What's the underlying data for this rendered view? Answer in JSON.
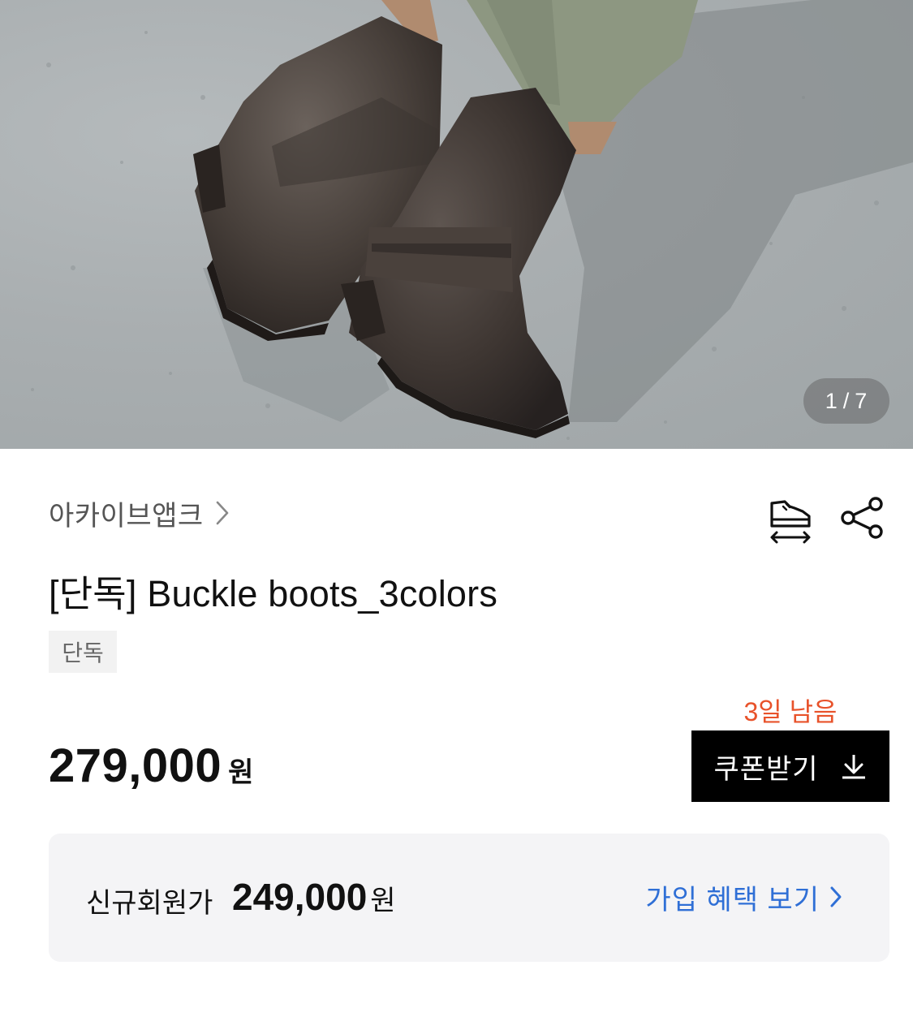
{
  "product_image": {
    "alt": "brown buckle boots",
    "counter_current": "1",
    "counter_separator": "/",
    "counter_total": "7"
  },
  "brand": {
    "name": "아카이브앱크",
    "chevron_icon": "chevron-right-icon"
  },
  "actions": {
    "size_icon": "shoe-size-icon",
    "share_icon": "share-icon"
  },
  "product": {
    "title": "[단독] Buckle boots_3colors",
    "tag": "단독"
  },
  "coupon": {
    "remaining": "3일 남음",
    "label": "쿠폰받기",
    "icon": "download-icon"
  },
  "price": {
    "amount": "279,000",
    "unit": "원"
  },
  "member_price": {
    "label": "신규회원가",
    "amount": "249,000",
    "unit": "원",
    "link_label": "가입 혜택 보기"
  },
  "colors": {
    "remaining_text": "#e8522a",
    "link_text": "#2f6fd6",
    "coupon_bg": "#000000"
  }
}
